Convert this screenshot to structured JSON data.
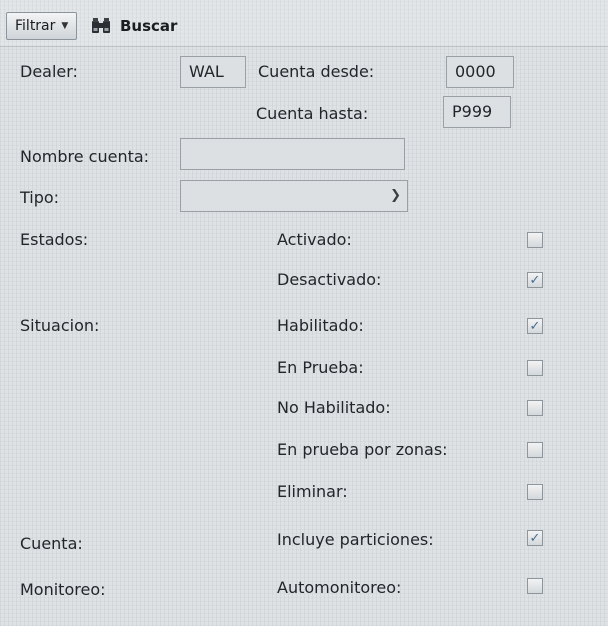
{
  "toolbar": {
    "filter_label": "Filtrar",
    "search_label": "Buscar"
  },
  "form": {
    "dealer_label": "Dealer:",
    "dealer_value": "WAL",
    "cuenta_desde_label": "Cuenta desde:",
    "cuenta_desde_value": "0000",
    "cuenta_hasta_label": "Cuenta hasta:",
    "cuenta_hasta_value": "P999",
    "nombre_cuenta_label": "Nombre cuenta:",
    "nombre_cuenta_value": "",
    "tipo_label": "Tipo:",
    "tipo_value": "",
    "estados_label": "Estados:",
    "situacion_label": "Situacion:",
    "cuenta_label": "Cuenta:",
    "monitoreo_label": "Monitoreo:"
  },
  "checkboxes": [
    {
      "label": "Activado:",
      "checked": false
    },
    {
      "label": "Desactivado:",
      "checked": true
    },
    {
      "label": "Habilitado:",
      "checked": true
    },
    {
      "label": "En Prueba:",
      "checked": false
    },
    {
      "label": "No Habilitado:",
      "checked": false
    },
    {
      "label": "En prueba por zonas:",
      "checked": false
    },
    {
      "label": "Eliminar:",
      "checked": false
    },
    {
      "label": "Incluye particiones:",
      "checked": true
    },
    {
      "label": "Automonitoreo:",
      "checked": false
    }
  ],
  "colors": {
    "check_mark": "#4a6b8f",
    "background": "#dfe2e4",
    "field_border": "#9aa1a6"
  }
}
